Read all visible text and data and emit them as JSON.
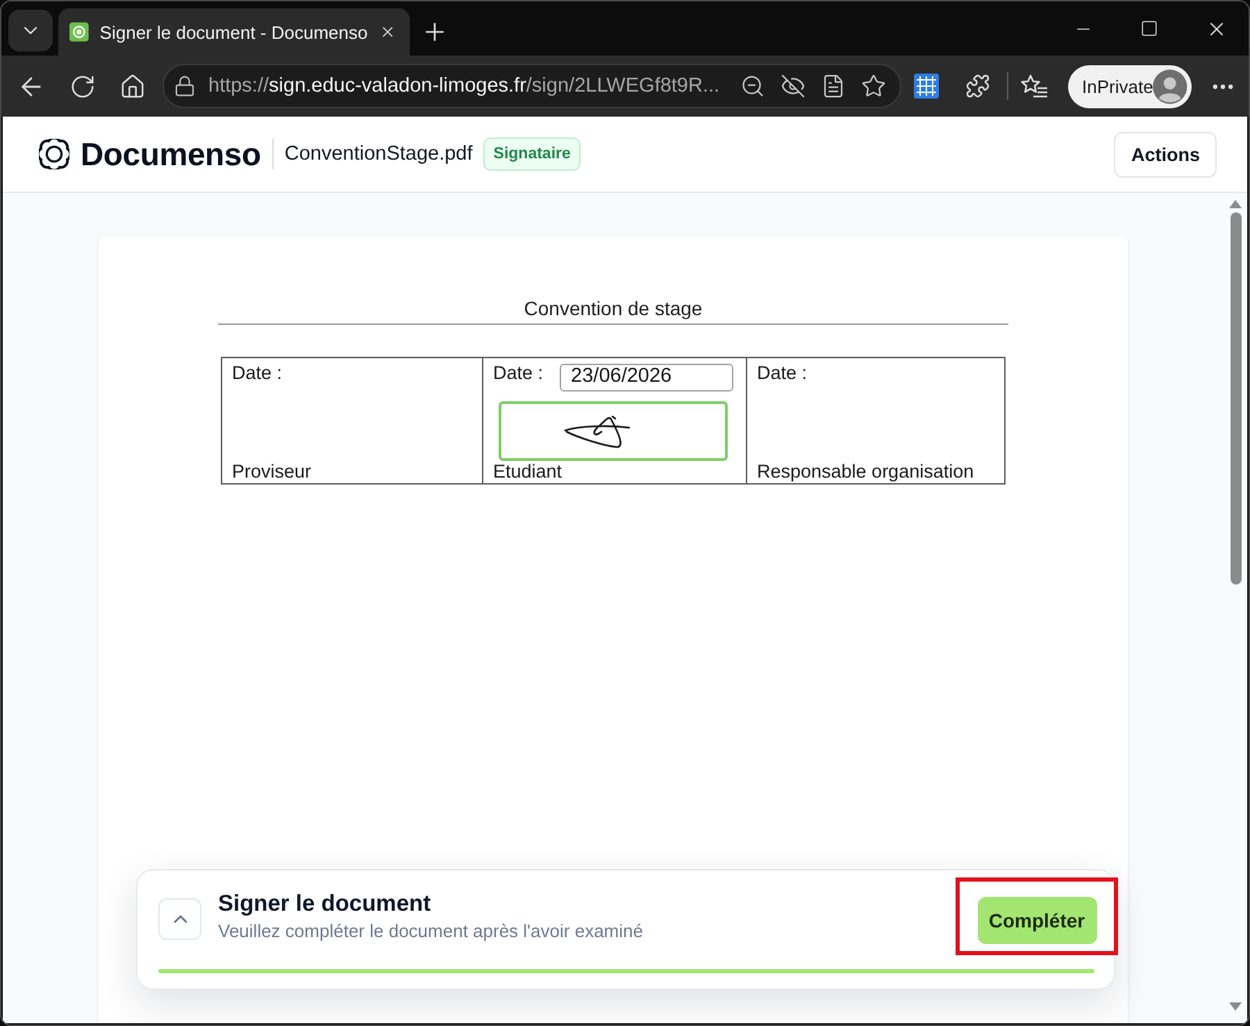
{
  "browser": {
    "tabs": [
      {
        "title": "Signer le document - Documenso",
        "selected": true
      }
    ],
    "address_bar": {
      "scheme": "https://",
      "host": "sign.educ-valadon-limoges.fr",
      "path": "/sign/2LLWEGf8t9R..."
    },
    "profile_button": "InPrivate"
  },
  "header": {
    "brand": "Documenso",
    "file_name": "ConventionStage.pdf",
    "role_badge": "Signataire",
    "actions_button": "Actions"
  },
  "document": {
    "title": "Convention de stage",
    "signature_table": [
      {
        "kind": "blank",
        "date_label": "Date :",
        "role": "Proviseur"
      },
      {
        "kind": "signed",
        "date_label": "Date :",
        "date_value": "23/06/2026",
        "role": "Etudiant"
      },
      {
        "kind": "blank",
        "date_label": "Date :",
        "role": "Responsable organisation"
      }
    ]
  },
  "sign_panel": {
    "title": "Signer le document",
    "subtitle": "Veuillez compléter le document après l'avoir examiné",
    "complete_button": {
      "label": "Compléter",
      "highlighted": true
    },
    "progress": {
      "level": 1
    }
  }
}
